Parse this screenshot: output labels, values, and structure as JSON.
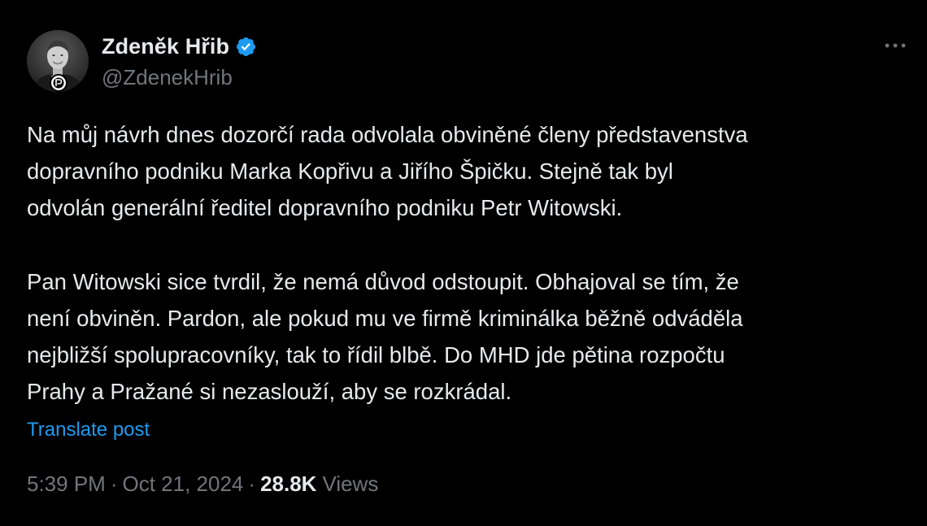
{
  "author": {
    "display_name": "Zdeněk Hřib",
    "handle": "@ZdenekHrib",
    "verified": true,
    "verified_color": "#1d9bf0",
    "avatar_icon": "profile-photo",
    "badge_icon": "pirate-party-badge"
  },
  "post": {
    "paragraph1": [
      "Na můj návrh dnes dozorčí rada odvolala obviněné členy představenstva",
      "dopravního podniku Marka Kopřivu a Jiřího Špičku. Stejně tak byl",
      "odvolán generální ředitel dopravního podniku Petr Witowski."
    ],
    "paragraph2": [
      "Pan Witowski sice tvrdil, že nemá důvod odstoupit. Obhajoval se tím, že",
      "není obviněn. Pardon, ale pokud mu ve firmě kriminálka běžně odváděla",
      "nejbližší spolupracovníky, tak to řídil blbě. Do MHD jde pětina rozpočtu",
      "Prahy a Pražané si nezaslouží, aby se rozkrádal."
    ],
    "translate_label": "Translate post"
  },
  "meta": {
    "time": "5:39 PM",
    "separator": "·",
    "date": "Oct 21, 2024",
    "views_count": "28.8K",
    "views_label": "Views"
  },
  "colors": {
    "background": "#000000",
    "text": "#e7e9ea",
    "secondary": "#71767b",
    "link": "#1d9bf0"
  },
  "icons": {
    "more": "more-horizontal-icon",
    "verified": "verified-badge-icon"
  }
}
